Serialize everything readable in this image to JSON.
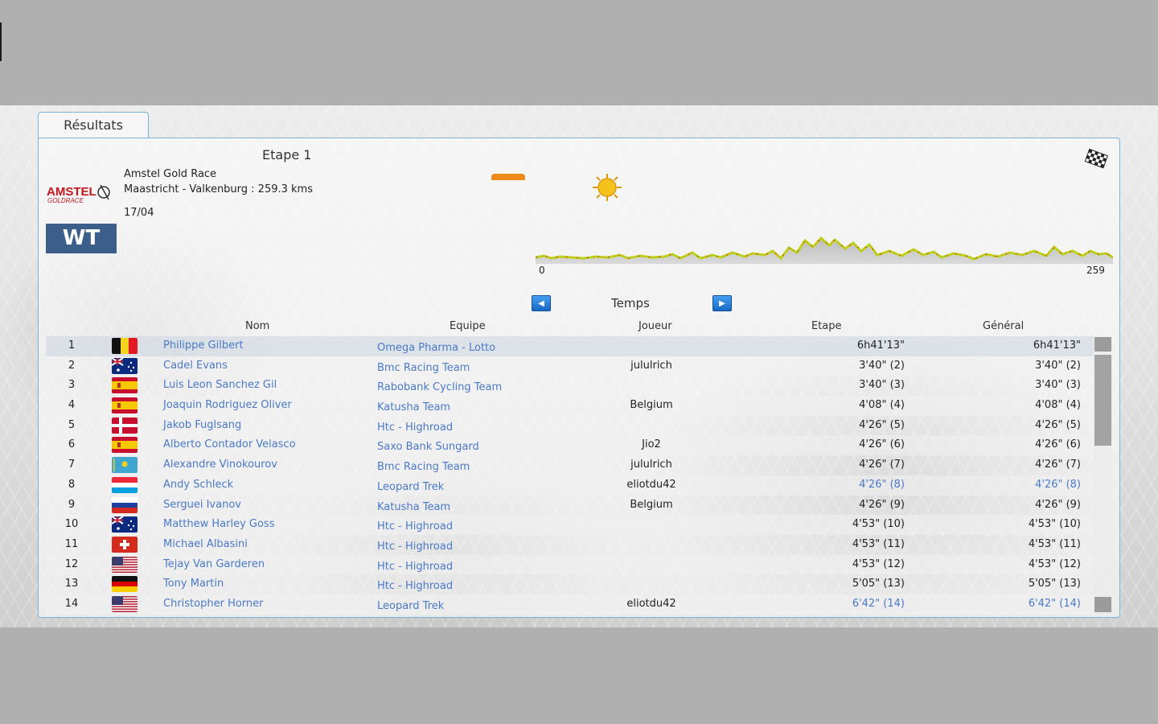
{
  "tab": {
    "label": "Résultats"
  },
  "race": {
    "stage_title": "Etape 1",
    "name": "Amstel Gold Race",
    "route": "Maastricht - Valkenburg : 259.3 kms",
    "date": "17/04",
    "logo_text": "AMSTEL",
    "logo_subtext": "GOLDRACE",
    "category_badge": "WT",
    "weather_icon": "sun-icon",
    "finish_icon": "checkered-flag-icon",
    "profile_start_km": "0",
    "profile_end_km": "259"
  },
  "ranking": {
    "label": "Temps",
    "prev_icon": "arrow-left-icon",
    "next_icon": "arrow-right-icon"
  },
  "columns": {
    "name": "Nom",
    "team": "Equipe",
    "player": "Joueur",
    "stage": "Etape",
    "gc": "Général"
  },
  "rows": [
    {
      "rank": "1",
      "flag": "Belgium",
      "name": "Philippe Gilbert",
      "team": "Omega Pharma - Lotto",
      "player": "",
      "stage": "6h41'13\"",
      "gc": "6h41'13\""
    },
    {
      "rank": "2",
      "flag": "Australia",
      "name": "Cadel Evans",
      "team": "Bmc Racing Team",
      "player": "jululrich",
      "stage": "3'40\" (2)",
      "gc": "3'40\" (2)"
    },
    {
      "rank": "3",
      "flag": "Spain",
      "name": "Luis Leon Sanchez Gil",
      "team": "Rabobank Cycling Team",
      "player": "",
      "stage": "3'40\" (3)",
      "gc": "3'40\" (3)"
    },
    {
      "rank": "4",
      "flag": "Spain",
      "name": "Joaquin Rodriguez Oliver",
      "team": "Katusha Team",
      "player": "Belgium",
      "stage": "4'08\" (4)",
      "gc": "4'08\" (4)"
    },
    {
      "rank": "5",
      "flag": "Denmark",
      "name": "Jakob Fuglsang",
      "team": "Htc - Highroad",
      "player": "",
      "stage": "4'26\" (5)",
      "gc": "4'26\" (5)"
    },
    {
      "rank": "6",
      "flag": "Spain",
      "name": "Alberto Contador Velasco",
      "team": "Saxo Bank Sungard",
      "player": "Jio2",
      "stage": "4'26\" (6)",
      "gc": "4'26\" (6)"
    },
    {
      "rank": "7",
      "flag": "Kazakhstan",
      "name": "Alexandre Vinokourov",
      "team": "Bmc Racing Team",
      "player": "jululrich",
      "stage": "4'26\" (7)",
      "gc": "4'26\" (7)"
    },
    {
      "rank": "8",
      "flag": "Luxembourg",
      "name": "Andy Schleck",
      "team": "Leopard Trek",
      "player": "eliotdu42",
      "stage": "4'26\" (8)",
      "gc": "4'26\" (8)",
      "highlight": true
    },
    {
      "rank": "9",
      "flag": "Russia",
      "name": "Serguei Ivanov",
      "team": "Katusha Team",
      "player": "Belgium",
      "stage": "4'26\" (9)",
      "gc": "4'26\" (9)"
    },
    {
      "rank": "10",
      "flag": "Australia",
      "name": "Matthew Harley Goss",
      "team": "Htc - Highroad",
      "player": "",
      "stage": "4'53\" (10)",
      "gc": "4'53\" (10)"
    },
    {
      "rank": "11",
      "flag": "Switzerland",
      "name": "Michael Albasini",
      "team": "Htc - Highroad",
      "player": "",
      "stage": "4'53\" (11)",
      "gc": "4'53\" (11)"
    },
    {
      "rank": "12",
      "flag": "United States",
      "name": "Tejay Van Garderen",
      "team": "Htc - Highroad",
      "player": "",
      "stage": "4'53\" (12)",
      "gc": "4'53\" (12)"
    },
    {
      "rank": "13",
      "flag": "Germany",
      "name": "Tony Martin",
      "team": "Htc - Highroad",
      "player": "",
      "stage": "5'05\" (13)",
      "gc": "5'05\" (13)"
    },
    {
      "rank": "14",
      "flag": "United States",
      "name": "Christopher Horner",
      "team": "Leopard Trek",
      "player": "eliotdu42",
      "stage": "6'42\" (14)",
      "gc": "6'42\" (14)",
      "highlight": true
    }
  ],
  "colors": {
    "accent": "#79b4d6",
    "link": "#4a79c8",
    "button": "#1767c4",
    "wind": "#ee8a1a"
  }
}
